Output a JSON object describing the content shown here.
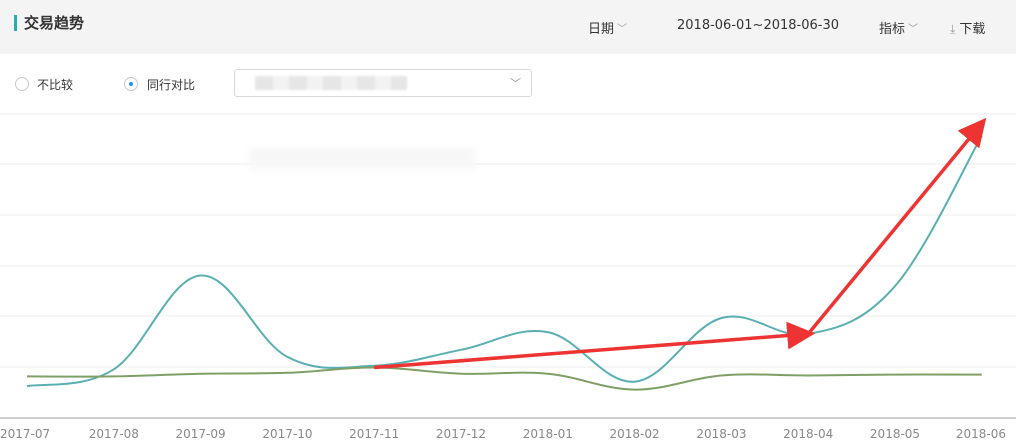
{
  "header": {
    "title": "交易趋势",
    "date_label": "日期",
    "date_range": "2018-06-01~2018-06-30",
    "metric_label": "指标",
    "download_label": "下载",
    "accent_color": "#20b2aa"
  },
  "filters": {
    "no_compare_label": "不比较",
    "peer_compare_label": "同行对比",
    "selected": "peer_compare"
  },
  "chart_data": {
    "type": "line",
    "categories": [
      "2017-07",
      "2017-08",
      "2017-09",
      "2017-10",
      "2017-11",
      "2017-12",
      "2018-01",
      "2018-02",
      "2018-03",
      "2018-04",
      "2018-05",
      "2018-06"
    ],
    "series": [
      {
        "color": "#5aafb3",
        "values": [
          3.5,
          13,
          66,
          20,
          15,
          24,
          34,
          6,
          42,
          33,
          60,
          145
        ]
      },
      {
        "color": "#7ea067",
        "values": [
          9,
          9,
          10.5,
          11,
          14,
          10.5,
          10.5,
          1.5,
          9.5,
          9.5,
          10,
          10
        ]
      }
    ],
    "ylim": [
      -10,
      155
    ],
    "grid": true,
    "annotations": [
      {
        "type": "arrow",
        "color": "#ee3333",
        "from": [
          "2017-11",
          14
        ],
        "to": [
          "2018-04",
          33
        ]
      },
      {
        "type": "arrow",
        "color": "#ee3333",
        "from": [
          "2018-04",
          33
        ],
        "to": [
          "2018-06",
          152
        ]
      }
    ]
  }
}
